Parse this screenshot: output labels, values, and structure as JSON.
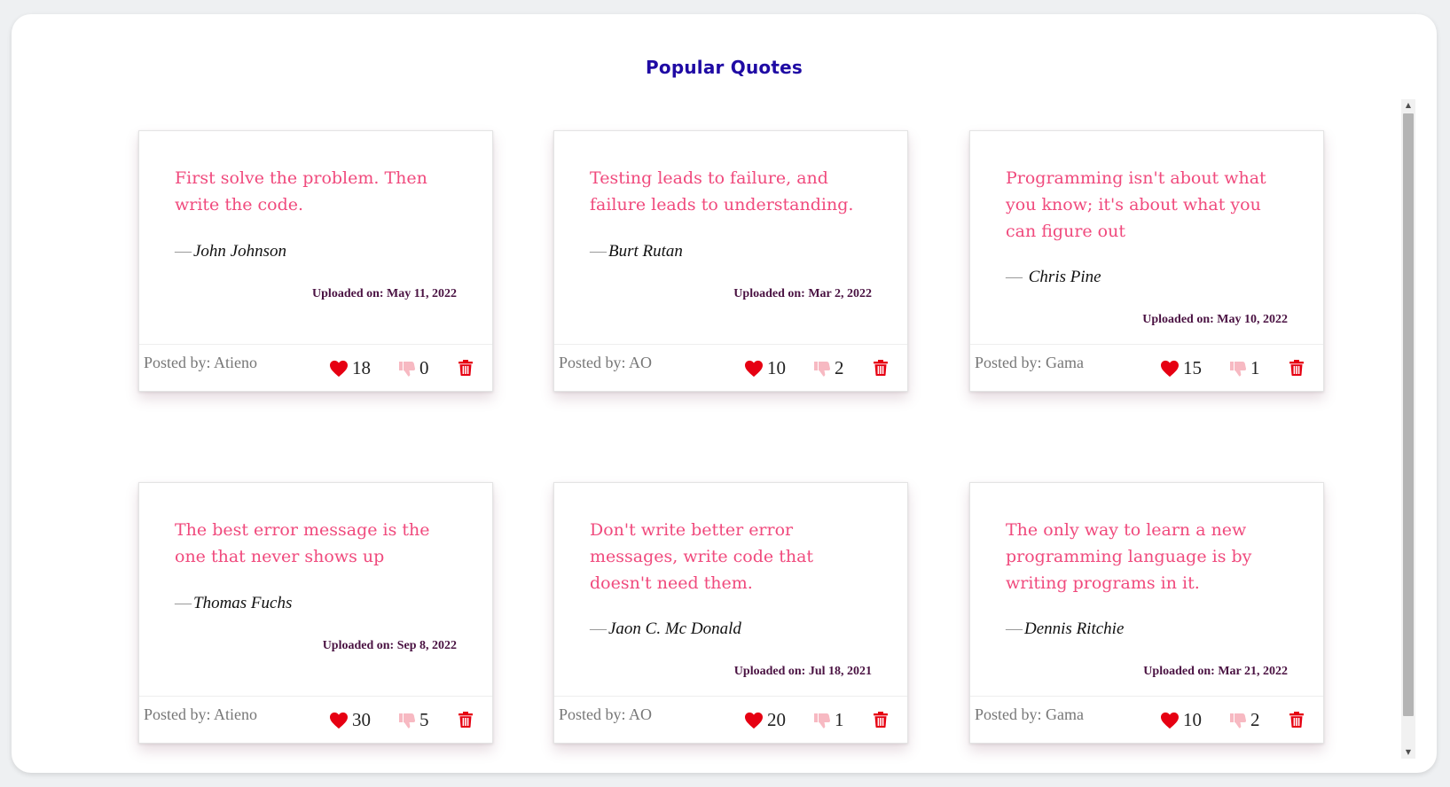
{
  "page": {
    "title": "Popular Quotes"
  },
  "colors": {
    "title": "#1f0aa4",
    "quote": "#f04a7d",
    "heart": "#e60012",
    "thumbs_down": "#f7b9c2",
    "delete": "#e60012",
    "uploaded": "#4a1242"
  },
  "quotes": [
    {
      "text": "First solve the problem. Then write the code.",
      "author": "John Johnson",
      "uploaded": "Uploaded on: May 11, 2022",
      "posted_by": "Posted by: Atieno",
      "likes": "18",
      "dislikes": "0"
    },
    {
      "text": "Testing leads to failure, and failure leads to understanding.",
      "author": "Burt Rutan",
      "uploaded": "Uploaded on: Mar 2, 2022",
      "posted_by": "Posted by: AO",
      "likes": "10",
      "dislikes": "2"
    },
    {
      "text": "Programming isn't about what you know; it's about what you can figure out",
      "author": "Chris Pine",
      "uploaded": "Uploaded on: May 10, 2022",
      "posted_by": "Posted by: Gama",
      "likes": "15",
      "dislikes": "1"
    },
    {
      "text": "The best error message is the one that never shows up",
      "author": "Thomas Fuchs",
      "uploaded": "Uploaded on: Sep 8, 2022",
      "posted_by": "Posted by: Atieno",
      "likes": "30",
      "dislikes": "5"
    },
    {
      "text": "Don't write better error messages, write code that doesn't need them.",
      "author": "Jaon C. Mc Donald",
      "uploaded": "Uploaded on: Jul 18, 2021",
      "posted_by": "Posted by: AO",
      "likes": "20",
      "dislikes": "1"
    },
    {
      "text": "The only way to learn a new programming language is by writing programs in it.",
      "author": "Dennis Ritchie",
      "uploaded": "Uploaded on: Mar 21, 2022",
      "posted_by": "Posted by: Gama",
      "likes": "10",
      "dislikes": "2"
    }
  ],
  "icons": {
    "like": "heart-icon",
    "dislike": "thumbs-down-icon",
    "delete": "trash-icon"
  }
}
